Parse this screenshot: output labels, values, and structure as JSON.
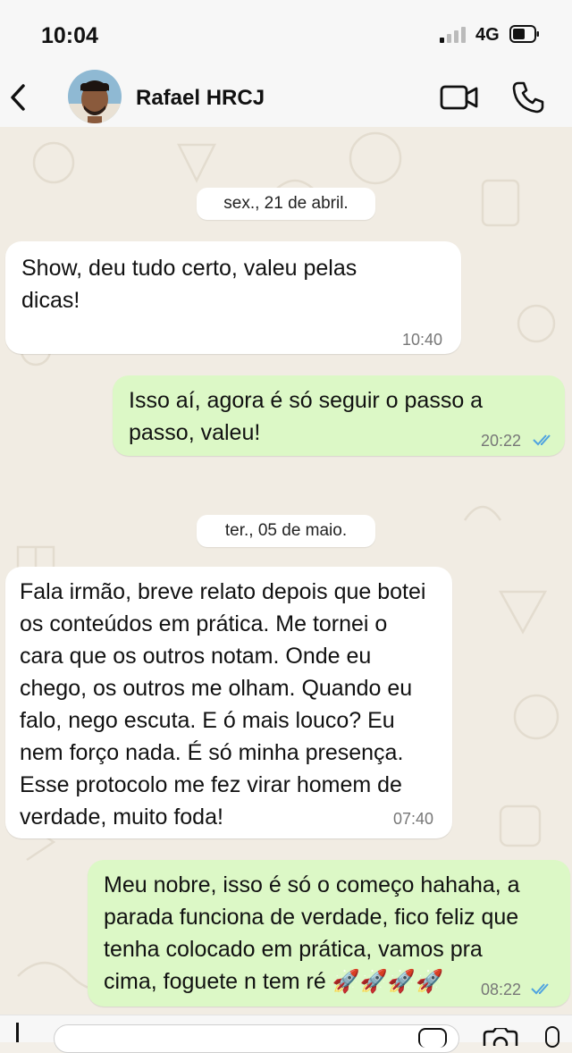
{
  "status_bar": {
    "time": "10:04",
    "network": "4G"
  },
  "header": {
    "contact_name": "Rafael HRCJ"
  },
  "chat": {
    "date_1": "sex., 21 de abril.",
    "date_2": "ter., 05 de maio.",
    "messages": [
      {
        "direction": "incoming",
        "text": "Show, deu tudo certo, valeu pelas\ndicas!",
        "time": "10:40"
      },
      {
        "direction": "outgoing",
        "text": "Isso aí, agora é só seguir o passo a\npasso, valeu!",
        "time": "20:22",
        "status": "read"
      },
      {
        "direction": "incoming",
        "text": "Fala irmão, breve relato depois que botei\nos conteúdos em prática. Me tornei o\ncara que os outros notam. Onde eu\nchego, os outros me olham. Quando eu\nfalo, nego escuta. E ó mais louco? Eu\nnem forço nada. É só minha presença.\nEsse protocolo me fez virar homem de\nverdade, muito foda!",
        "time": "07:40"
      },
      {
        "direction": "outgoing",
        "text": "Meu nobre, isso é só o começo hahaha, a\nparada funciona de verdade, fico feliz que\ntenha colocado em prática, vamos pra\ncima, foguete n tem ré 🚀🚀🚀🚀",
        "time": "08:22",
        "status": "read"
      }
    ]
  },
  "icons": [
    "back-arrow-icon",
    "video-call-icon",
    "phone-icon",
    "read-ticks-icon",
    "plus-icon",
    "sticker-icon",
    "camera-icon",
    "mic-icon"
  ],
  "colors": {
    "incoming_bubble": "#ffffff",
    "outgoing_bubble": "#dcf8c6",
    "read_ticks": "#4fa3e0",
    "wallpaper": "#f1ece3"
  }
}
